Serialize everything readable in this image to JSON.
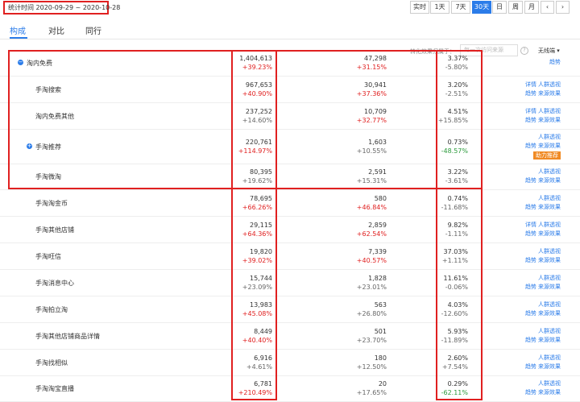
{
  "stat_time": "统计时间 2020-09-29 ~ 2020-10-28",
  "date_buttons": [
    {
      "label": "实时",
      "active": false
    },
    {
      "label": "1天",
      "active": false
    },
    {
      "label": "7天",
      "active": false
    },
    {
      "label": "30天",
      "active": true
    },
    {
      "label": "日",
      "active": false
    },
    {
      "label": "周",
      "active": false
    },
    {
      "label": "月",
      "active": false
    }
  ],
  "tabs": [
    "构成",
    "对比",
    "同行"
  ],
  "active_tab": "构成",
  "conversion_label": "转化效果归属于：",
  "conversion_select": "每一次访问来源",
  "attribution_select": "无线端",
  "rows": [
    {
      "name": "淘内免费",
      "level": 0,
      "expand": true,
      "v1": "1,404,613",
      "c1": "+39.23%",
      "c1_color": "red",
      "v2": "47,298",
      "c2": "+31.15%",
      "c2_color": "red",
      "v3": "3.37%",
      "c3": "-5.80%",
      "c3_color": "gray",
      "links": [
        [
          "趋势"
        ]
      ],
      "badge": null
    },
    {
      "name": "手淘搜索",
      "level": 1,
      "expand": false,
      "v1": "967,653",
      "c1": "+40.90%",
      "c1_color": "red",
      "v2": "30,941",
      "c2": "+37.36%",
      "c2_color": "red",
      "v3": "3.20%",
      "c3": "-2.51%",
      "c3_color": "gray",
      "links": [
        [
          "详情",
          "人群透视"
        ],
        [
          "趋势",
          "来源效果"
        ]
      ],
      "badge": null
    },
    {
      "name": "淘内免费其他",
      "level": 1,
      "expand": false,
      "v1": "237,252",
      "c1": "+14.60%",
      "c1_color": "gray",
      "v2": "10,709",
      "c2": "+32.77%",
      "c2_color": "red",
      "v3": "4.51%",
      "c3": "+15.85%",
      "c3_color": "gray",
      "links": [
        [
          "详情",
          "人群透视"
        ],
        [
          "趋势",
          "来源效果"
        ]
      ],
      "badge": null
    },
    {
      "name": "手淘推荐",
      "level": 1,
      "expand": true,
      "v1": "220,761",
      "c1": "+114.97%",
      "c1_color": "red",
      "v2": "1,603",
      "c2": "+10.55%",
      "c2_color": "gray",
      "v3": "0.73%",
      "c3": "-48.57%",
      "c3_color": "green",
      "links": [
        [
          "人群透视"
        ],
        [
          "趋势",
          "来源效果"
        ]
      ],
      "badge": "助力推荐"
    },
    {
      "name": "手淘微淘",
      "level": 1,
      "expand": false,
      "v1": "80,395",
      "c1": "+19.62%",
      "c1_color": "gray",
      "v2": "2,591",
      "c2": "+15.31%",
      "c2_color": "gray",
      "v3": "3.22%",
      "c3": "-3.61%",
      "c3_color": "gray",
      "links": [
        [
          "人群透视"
        ],
        [
          "趋势",
          "来源效果"
        ]
      ],
      "badge": null
    },
    {
      "name": "手淘淘金币",
      "level": 1,
      "expand": false,
      "v1": "78,695",
      "c1": "+66.26%",
      "c1_color": "red",
      "v2": "580",
      "c2": "+46.84%",
      "c2_color": "red",
      "v3": "0.74%",
      "c3": "-11.68%",
      "c3_color": "gray",
      "links": [
        [
          "人群透视"
        ],
        [
          "趋势",
          "来源效果"
        ]
      ],
      "badge": null
    },
    {
      "name": "手淘其他店铺",
      "level": 1,
      "expand": false,
      "v1": "29,115",
      "c1": "+64.36%",
      "c1_color": "red",
      "v2": "2,859",
      "c2": "+62.54%",
      "c2_color": "red",
      "v3": "9.82%",
      "c3": "-1.11%",
      "c3_color": "gray",
      "links": [
        [
          "详情",
          "人群透视"
        ],
        [
          "趋势",
          "来源效果"
        ]
      ],
      "badge": null
    },
    {
      "name": "手淘旺信",
      "level": 1,
      "expand": false,
      "v1": "19,820",
      "c1": "+39.02%",
      "c1_color": "red",
      "v2": "7,339",
      "c2": "+40.57%",
      "c2_color": "red",
      "v3": "37.03%",
      "c3": "+1.11%",
      "c3_color": "gray",
      "links": [
        [
          "人群透视"
        ],
        [
          "趋势",
          "来源效果"
        ]
      ],
      "badge": null
    },
    {
      "name": "手淘消息中心",
      "level": 1,
      "expand": false,
      "v1": "15,744",
      "c1": "+23.09%",
      "c1_color": "gray",
      "v2": "1,828",
      "c2": "+23.01%",
      "c2_color": "gray",
      "v3": "11.61%",
      "c3": "-0.06%",
      "c3_color": "gray",
      "links": [
        [
          "人群透视"
        ],
        [
          "趋势",
          "来源效果"
        ]
      ],
      "badge": null
    },
    {
      "name": "手淘拍立淘",
      "level": 1,
      "expand": false,
      "v1": "13,983",
      "c1": "+45.08%",
      "c1_color": "red",
      "v2": "563",
      "c2": "+26.80%",
      "c2_color": "gray",
      "v3": "4.03%",
      "c3": "-12.60%",
      "c3_color": "gray",
      "links": [
        [
          "人群透视"
        ],
        [
          "趋势",
          "来源效果"
        ]
      ],
      "badge": null
    },
    {
      "name": "手淘其他店铺商品详情",
      "level": 1,
      "expand": false,
      "v1": "8,449",
      "c1": "+40.40%",
      "c1_color": "red",
      "v2": "501",
      "c2": "+23.70%",
      "c2_color": "gray",
      "v3": "5.93%",
      "c3": "-11.89%",
      "c3_color": "gray",
      "links": [
        [
          "人群透视"
        ],
        [
          "趋势",
          "来源效果"
        ]
      ],
      "badge": null
    },
    {
      "name": "手淘找相似",
      "level": 1,
      "expand": false,
      "v1": "6,916",
      "c1": "+4.61%",
      "c1_color": "gray",
      "v2": "180",
      "c2": "+12.50%",
      "c2_color": "gray",
      "v3": "2.60%",
      "c3": "+7.54%",
      "c3_color": "gray",
      "links": [
        [
          "人群透视"
        ],
        [
          "趋势",
          "来源效果"
        ]
      ],
      "badge": null
    },
    {
      "name": "手淘淘宝直播",
      "level": 1,
      "expand": false,
      "v1": "6,781",
      "c1": "+210.49%",
      "c1_color": "red",
      "v2": "20",
      "c2": "+17.65%",
      "c2_color": "gray",
      "v3": "0.29%",
      "c3": "-62.11%",
      "c3_color": "green",
      "links": [
        [
          "人群透视"
        ],
        [
          "趋势",
          "来源效果"
        ]
      ],
      "badge": null
    }
  ],
  "colors": {
    "accent": "#2b7ce9",
    "highlight_box": "#e02020",
    "up": "#e02020",
    "down": "#2a9a3a",
    "badge": "#f08a24"
  }
}
